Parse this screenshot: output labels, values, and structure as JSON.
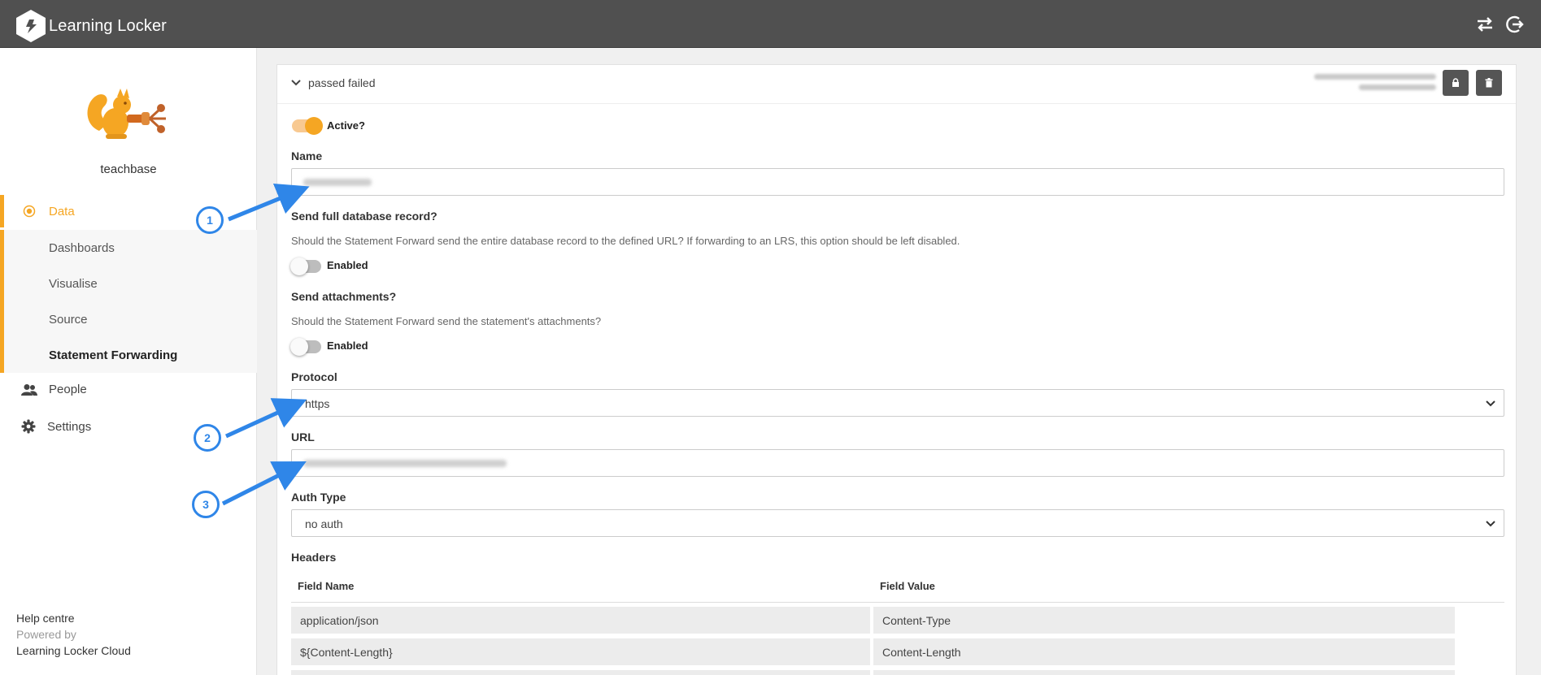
{
  "app": {
    "title": "Learning Locker"
  },
  "top_icons": [
    "swap-icon",
    "logout-icon"
  ],
  "sidebar": {
    "org_name": "teachbase",
    "data_label": "Data",
    "sub_items": [
      {
        "label": "Dashboards",
        "active": false
      },
      {
        "label": "Visualise",
        "active": false
      },
      {
        "label": "Source",
        "active": false
      },
      {
        "label": "Statement Forwarding",
        "active": true
      }
    ],
    "people_label": "People",
    "settings_label": "Settings",
    "footer": {
      "help": "Help centre",
      "powered": "Powered by",
      "cloud": "Learning Locker Cloud"
    }
  },
  "panel": {
    "title": "passed failed",
    "active_label": "Active?",
    "active": true,
    "name": {
      "label": "Name"
    },
    "send_full": {
      "label": "Send full database record?",
      "help": "Should the Statement Forward send the entire database record to the defined URL? If forwarding to an LRS, this option should be left disabled.",
      "toggle_label": "Enabled",
      "enabled": false
    },
    "send_attachments": {
      "label": "Send attachments?",
      "help": "Should the Statement Forward send the statement's attachments?",
      "toggle_label": "Enabled",
      "enabled": false
    },
    "protocol": {
      "label": "Protocol",
      "value": "https"
    },
    "url": {
      "label": "URL"
    },
    "auth": {
      "label": "Auth Type",
      "value": "no auth"
    },
    "headers": {
      "label": "Headers",
      "columns": [
        "Field Name",
        "Field Value"
      ],
      "rows": [
        [
          "application/json",
          "Content-Type"
        ],
        [
          "${Content-Length}",
          "Content-Length"
        ]
      ]
    }
  },
  "annotations": [
    "1",
    "2",
    "3"
  ],
  "colors": {
    "accent": "#f5a623",
    "topbar": "#505050",
    "annotation": "#2f86e8"
  }
}
